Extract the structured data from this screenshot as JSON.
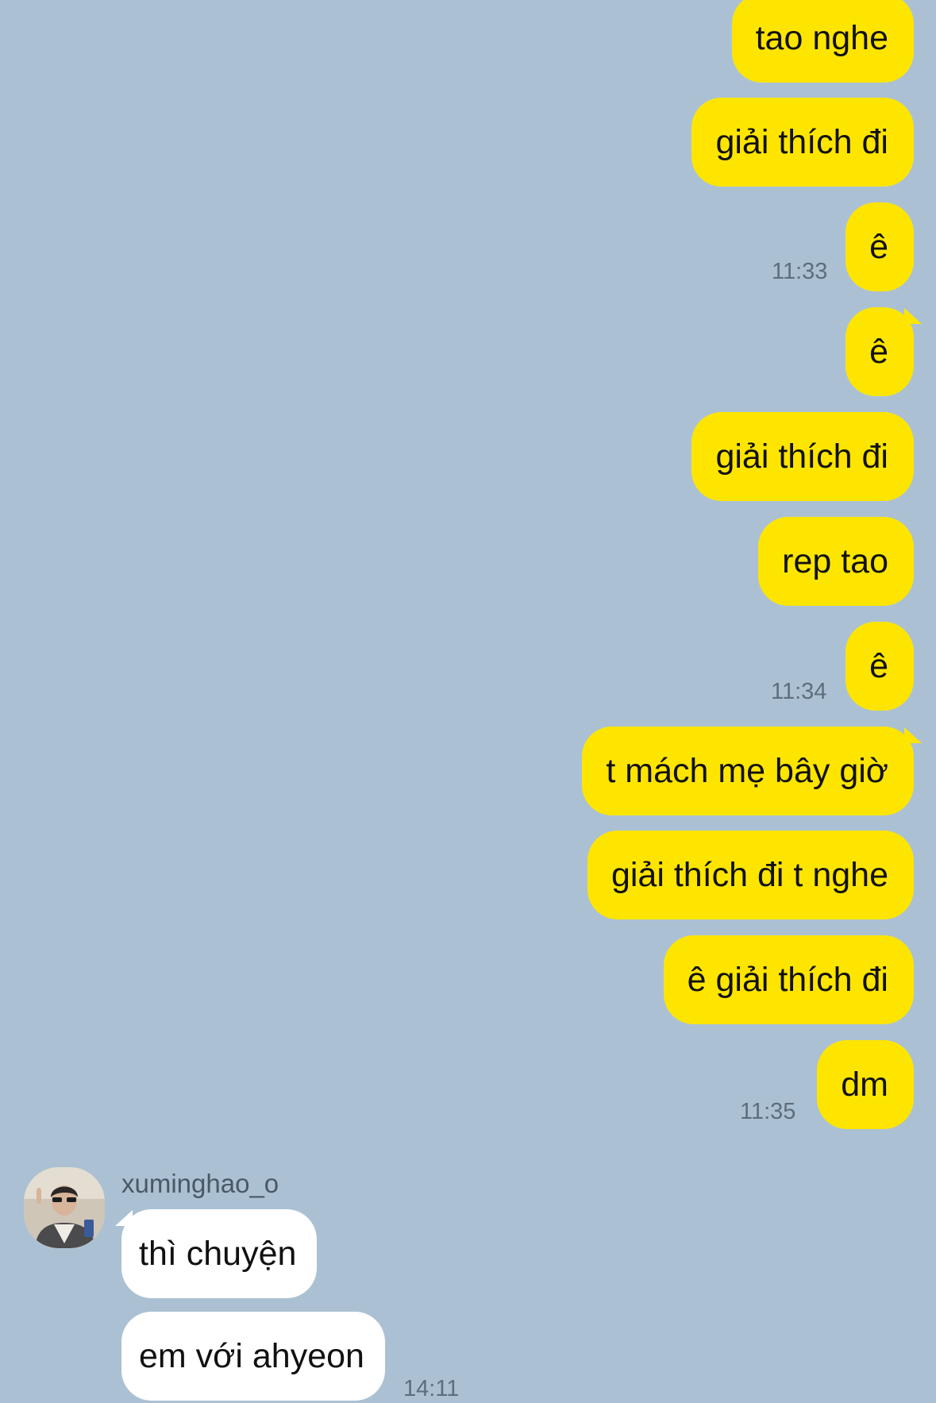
{
  "colors": {
    "background": "#abc1d3",
    "my_bubble": "#fee500",
    "their_bubble": "#ffffff",
    "timestamp": "#5e6d7b"
  },
  "messages_me": [
    {
      "text": "tao nghe"
    },
    {
      "text": "giải thích đi"
    },
    {
      "text": "ê",
      "time": "11:33"
    },
    {
      "text": "ê"
    },
    {
      "text": "giải thích đi"
    },
    {
      "text": "rep tao"
    },
    {
      "text": "ê",
      "time": "11:34"
    },
    {
      "text": "t mách mẹ bây giờ"
    },
    {
      "text": "giải thích đi t nghe"
    },
    {
      "text": "ê giải thích đi"
    },
    {
      "text": "dm",
      "time": "11:35"
    }
  ],
  "contact": {
    "username": "xuminghao_o",
    "avatar_icon": "profile-photo-icon"
  },
  "messages_them": [
    {
      "text": "thì chuyện"
    },
    {
      "text": "em với ahyeon",
      "time": "14:11"
    }
  ]
}
